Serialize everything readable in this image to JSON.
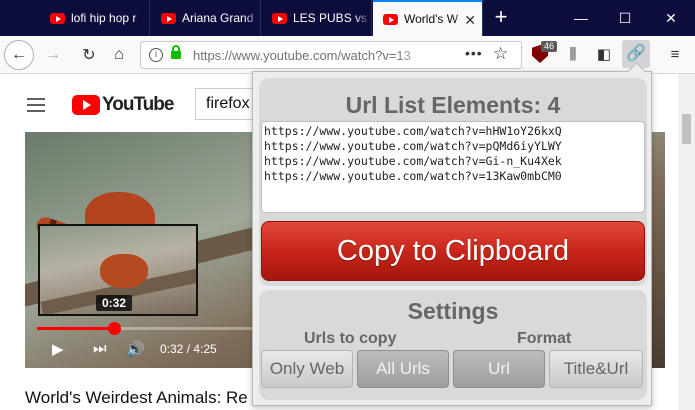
{
  "tabs": [
    {
      "label": "lofi hip hop r"
    },
    {
      "label": "Ariana Grand"
    },
    {
      "label": "LES PUBS vs"
    },
    {
      "label": "World's W",
      "active": true
    }
  ],
  "toolbar": {
    "url": "https://www.youtube.com/watch?v=13",
    "ublock_count": "46"
  },
  "page": {
    "logo_text": "YouTube",
    "search_value": "firefox",
    "preview_time": "0:32",
    "timecode": "0:32 / 4:25",
    "progress_fraction": 0.35,
    "video_title": "World's Weirdest Animals: Re"
  },
  "popup": {
    "title": "Url List Elements: 4",
    "urls": [
      "https://www.youtube.com/watch?v=hHW1oY26kxQ",
      "https://www.youtube.com/watch?v=pQMd6iyYLWY",
      "https://www.youtube.com/watch?v=Gi-n_Ku4Xek",
      "https://www.youtube.com/watch?v=13Kaw0mbCM0"
    ],
    "copy_label": "Copy to Clipboard",
    "settings_title": "Settings",
    "urls_to_copy_label": "Urls to copy",
    "format_label": "Format",
    "options": {
      "only_web": "Only Web",
      "all_urls": "All Urls",
      "url": "Url",
      "title_url": "Title&Url"
    }
  },
  "colors": {
    "tab_bg": "#0c0c3d",
    "accent": "#0a84ff",
    "copy_button": "#c9251a",
    "youtube_red": "#ff0000"
  }
}
